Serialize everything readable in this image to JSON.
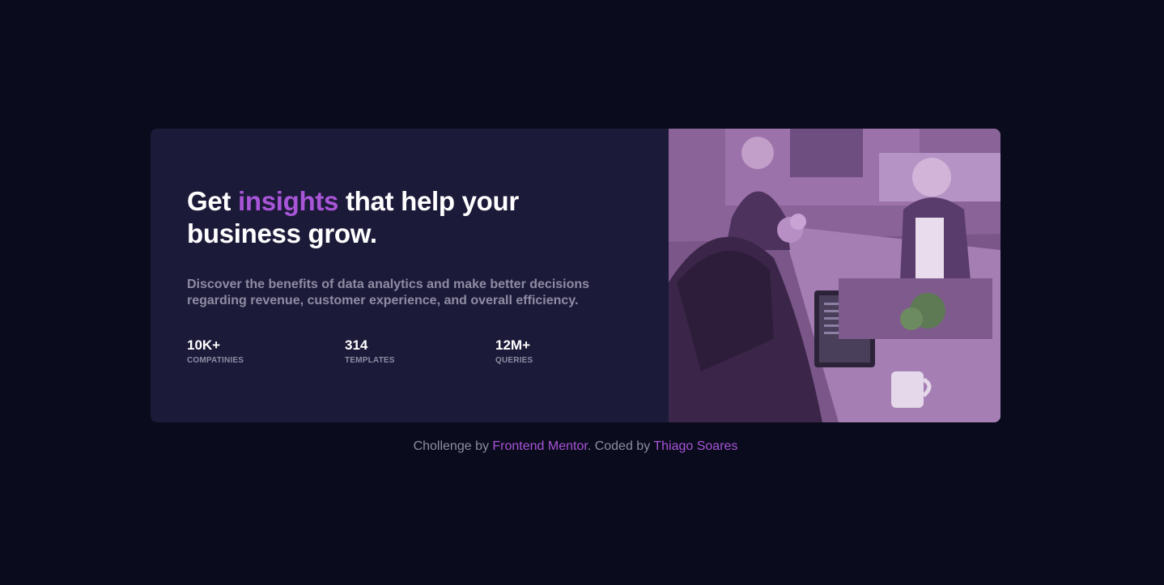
{
  "card": {
    "headline": {
      "before": "Get ",
      "accent": "insights",
      "after": " that help your business grow."
    },
    "description": "Discover the benefits of data analytics and make better decisions regarding revenue, customer experience, and overall efficiency.",
    "stats": [
      {
        "value": "10K+",
        "label": "COMPATINIES"
      },
      {
        "value": "314",
        "label": "TEMPLATES"
      },
      {
        "value": "12M+",
        "label": "QUERIES"
      }
    ],
    "image_icon": "office-team-photo"
  },
  "footer": {
    "prefix": "Chollenge by ",
    "link1": "Frontend Mentor",
    "middle": ". Coded by ",
    "link2": "Thiago Soares"
  },
  "colors": {
    "background": "#0a0b1c",
    "card": "#1c1a39",
    "accent": "#a855d8",
    "muted_text": "#8e8ca3",
    "image_tint": "#8a6399"
  }
}
